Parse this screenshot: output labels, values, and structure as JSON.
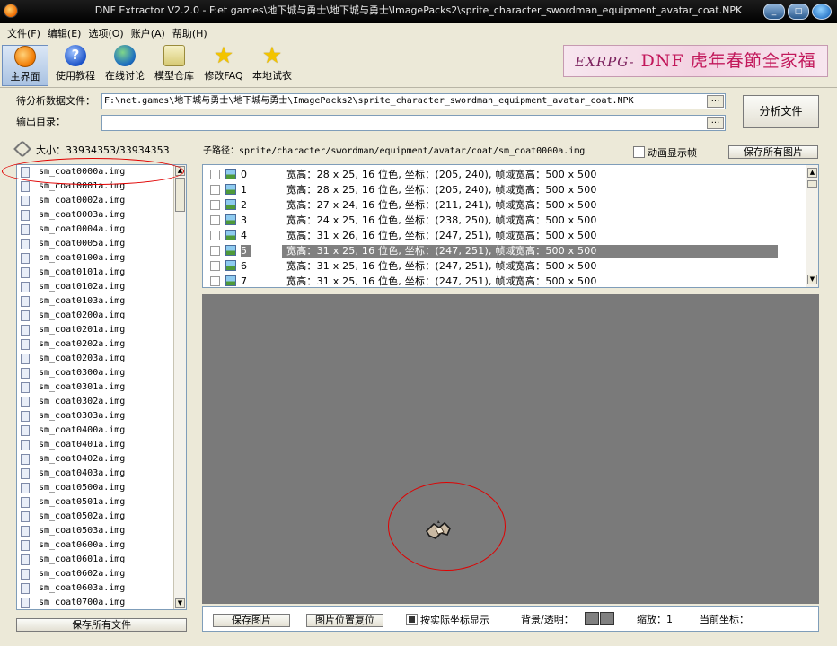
{
  "window": {
    "title": "DNF Extractor V2.2.0 - F:et games\\地下城与勇士\\地下城与勇士\\ImagePacks2\\sprite_character_swordman_equipment_avatar_coat.NPK",
    "min": "_",
    "max": "□"
  },
  "menu": [
    "文件(F)",
    "编辑(E)",
    "选项(O)",
    "账户(A)",
    "帮助(H)"
  ],
  "toolbar": [
    {
      "label": "主界面",
      "icon": "disc-icon"
    },
    {
      "label": "使用教程",
      "icon": "help-icon"
    },
    {
      "label": "在线讨论",
      "icon": "globe-icon"
    },
    {
      "label": "模型仓库",
      "icon": "package-icon"
    },
    {
      "label": "修改FAQ",
      "icon": "star-icon"
    },
    {
      "label": "本地试衣",
      "icon": "star-icon"
    }
  ],
  "banner": {
    "a": "EXRPG-",
    "b": "DNF",
    "c": "虎年春節全家福"
  },
  "form": {
    "input_label": "待分析数据文件：",
    "input_value": "F:\\net.games\\地下城与勇士\\地下城与勇士\\ImagePacks2\\sprite_character_swordman_equipment_avatar_coat.NPK",
    "output_label": "输出目录：",
    "output_value": "",
    "browse": "...",
    "analyze": "分析文件"
  },
  "size_text": "大小：33934353/33934353",
  "subpath": "子路径：sprite/character/swordman/equipment/avatar/coat/sm_coat0000a.img",
  "animate_label": "动画显示帧",
  "save_all_images": "保存所有图片",
  "save_all_files": "保存所有文件",
  "files": [
    "sm_coat0000a.img",
    "sm_coat0001a.img",
    "sm_coat0002a.img",
    "sm_coat0003a.img",
    "sm_coat0004a.img",
    "sm_coat0005a.img",
    "sm_coat0100a.img",
    "sm_coat0101a.img",
    "sm_coat0102a.img",
    "sm_coat0103a.img",
    "sm_coat0200a.img",
    "sm_coat0201a.img",
    "sm_coat0202a.img",
    "sm_coat0203a.img",
    "sm_coat0300a.img",
    "sm_coat0301a.img",
    "sm_coat0302a.img",
    "sm_coat0303a.img",
    "sm_coat0400a.img",
    "sm_coat0401a.img",
    "sm_coat0402a.img",
    "sm_coat0403a.img",
    "sm_coat0500a.img",
    "sm_coat0501a.img",
    "sm_coat0502a.img",
    "sm_coat0503a.img",
    "sm_coat0600a.img",
    "sm_coat0601a.img",
    "sm_coat0602a.img",
    "sm_coat0603a.img",
    "sm_coat0700a.img"
  ],
  "frames": [
    {
      "id": "0",
      "text": "宽高：28 x 25, 16 位色, 坐标：(205, 240), 帧域宽高：500 x 500"
    },
    {
      "id": "1",
      "text": "宽高：28 x 25, 16 位色, 坐标：(205, 240), 帧域宽高：500 x 500"
    },
    {
      "id": "2",
      "text": "宽高：27 x 24, 16 位色, 坐标：(211, 241), 帧域宽高：500 x 500"
    },
    {
      "id": "3",
      "text": "宽高：24 x 25, 16 位色, 坐标：(238, 250), 帧域宽高：500 x 500"
    },
    {
      "id": "4",
      "text": "宽高：31 x 26, 16 位色, 坐标：(247, 251), 帧域宽高：500 x 500"
    },
    {
      "id": "5",
      "text": "宽高：31 x 25, 16 位色, 坐标：(247, 251), 帧域宽高：500 x 500",
      "selected": true
    },
    {
      "id": "6",
      "text": "宽高：31 x 25, 16 位色, 坐标：(247, 251), 帧域宽高：500 x 500"
    },
    {
      "id": "7",
      "text": "宽高：31 x 25, 16 位色, 坐标：(247, 251), 帧域宽高：500 x 500"
    }
  ],
  "bottom": {
    "save_image": "保存图片",
    "reset_position": "图片位置复位",
    "actual_coord": "按实际坐标显示",
    "bg_label": "背景/透明：",
    "zoom_label": "缩放：1",
    "coord_label": "当前坐标："
  },
  "colors": {
    "selection": "#808080",
    "canvas": "#7a7a7a",
    "annotation": "#e00000"
  }
}
